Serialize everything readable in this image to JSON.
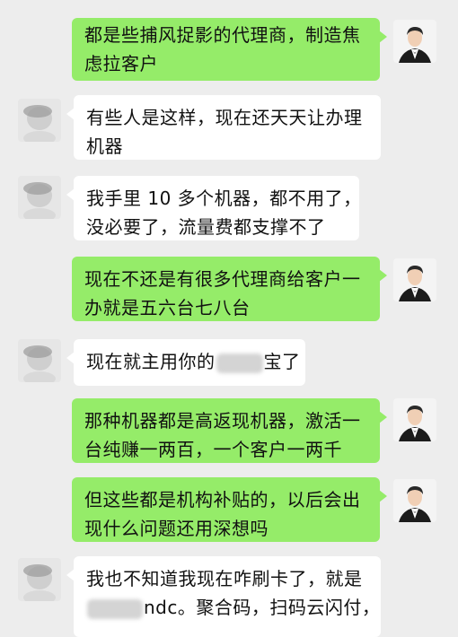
{
  "messages": [
    {
      "side": "right",
      "lines": [
        "都是些捕风捉影的代理商，制造焦",
        "虑拉客户"
      ]
    },
    {
      "side": "left",
      "lines": [
        "有些人是这样，现在还天天让办理",
        "机器"
      ]
    },
    {
      "side": "left",
      "lines": [
        "我手里 10 多个机器，都不用了，",
        "没必要了，流量费都支撑不了"
      ]
    },
    {
      "side": "right",
      "lines": [
        "现在不还是有很多代理商给客户一",
        "办就是五六台七八台"
      ]
    },
    {
      "side": "left",
      "lines_parts": [
        [
          "现在就主用你的",
          "",
          "宝了"
        ]
      ]
    },
    {
      "side": "right",
      "lines": [
        "那种机器都是高返现机器，激活一",
        "台纯赚一两百，一个客户一两千"
      ]
    },
    {
      "side": "right",
      "lines": [
        "但这些都是机构补贴的，以后会出",
        "现什么问题还用深想吗"
      ]
    },
    {
      "side": "left",
      "lines": [
        "我也不知道我现在咋刷卡了，就是"
      ],
      "last_line_parts": [
        "",
        "ndc。聚合码，扫码云闪付，"
      ]
    }
  ],
  "colors": {
    "sent_bubble": "#95ec69",
    "received_bubble": "#ffffff",
    "background": "#ededed"
  },
  "avatars": {
    "left": "blurred-contact-avatar",
    "right": "man-in-suit-avatar"
  }
}
